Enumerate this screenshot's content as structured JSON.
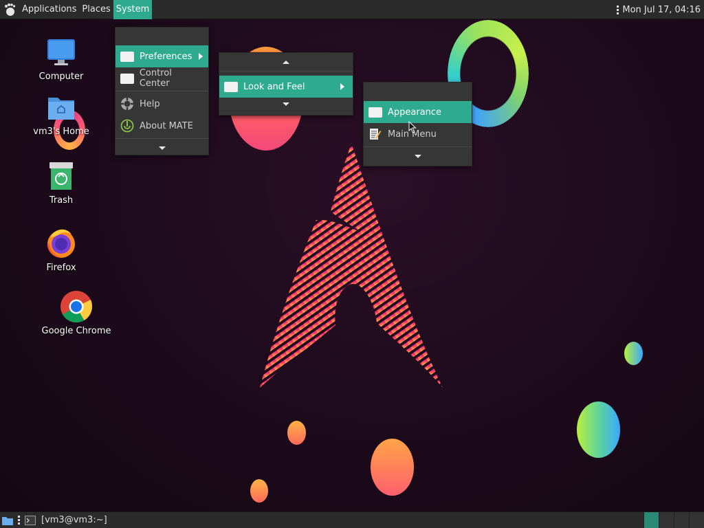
{
  "top_panel": {
    "menus": [
      "Applications",
      "Places",
      "System"
    ],
    "clock": "Mon Jul 17, 04:16"
  },
  "desktop": {
    "icons": [
      {
        "label": "Computer",
        "icon": "computer-icon"
      },
      {
        "label": "vm3's Home",
        "icon": "home-folder-icon"
      },
      {
        "label": "Trash",
        "icon": "trash-icon"
      },
      {
        "label": "Firefox",
        "icon": "firefox-icon"
      },
      {
        "label": "Google Chrome",
        "icon": "chrome-icon"
      }
    ]
  },
  "system_menu": {
    "items": [
      {
        "label": "Preferences",
        "icon": "blank-icon",
        "submenu": true
      },
      {
        "label": "Control Center",
        "icon": "blank-icon"
      },
      {
        "label": "Help",
        "icon": "help-icon"
      },
      {
        "label": "About MATE",
        "icon": "mate-icon"
      }
    ]
  },
  "preferences_menu": {
    "items": [
      {
        "label": "Look and Feel",
        "icon": "blank-icon",
        "submenu": true
      }
    ]
  },
  "look_and_feel_menu": {
    "items": [
      {
        "label": "Appearance",
        "icon": "blank-icon"
      },
      {
        "label": "Main Menu",
        "icon": "menu-editor-icon"
      }
    ]
  },
  "bottom_panel": {
    "task": "[vm3@vm3:~]"
  },
  "colors": {
    "accent": "#2eaa8f",
    "panel": "#2b2b2b",
    "menu_bg": "#363636"
  }
}
